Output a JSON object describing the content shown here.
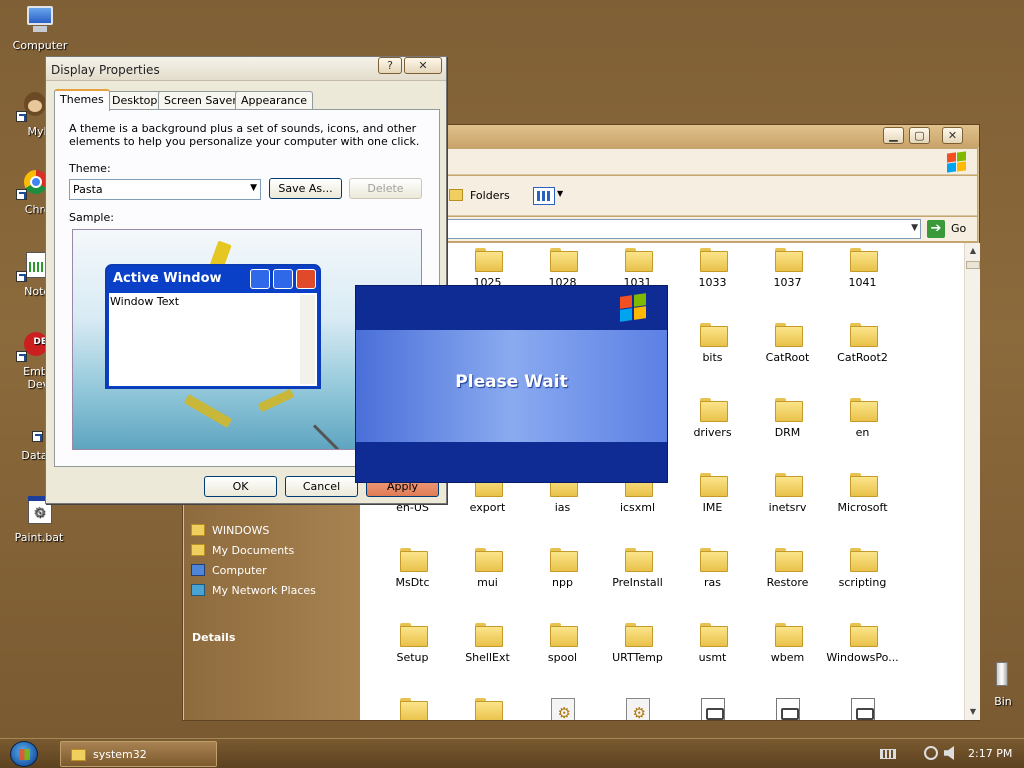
{
  "desktop": {
    "icons": [
      {
        "label": "Computer"
      },
      {
        "label": "MyPa"
      },
      {
        "label": "Chrom"
      },
      {
        "label": "Notepa"
      },
      {
        "label": "Embarc Dev-C"
      },
      {
        "label": "DataWa"
      },
      {
        "label": "Paint.bat"
      },
      {
        "label": "Bin"
      }
    ]
  },
  "explorer": {
    "toolbar": {
      "folders_label": "Folders"
    },
    "address": {
      "value": "",
      "go_label": "Go"
    },
    "tasks": [
      {
        "label": "WINDOWS",
        "icon": "folder-icon"
      },
      {
        "label": "My Documents",
        "icon": "my-documents-icon"
      },
      {
        "label": "Computer",
        "icon": "computer-icon"
      },
      {
        "label": "My Network Places",
        "icon": "network-places-icon"
      }
    ],
    "details_label": "Details",
    "files": [
      {
        "name": "1025",
        "type": "folder"
      },
      {
        "name": "1028",
        "type": "folder"
      },
      {
        "name": "1031",
        "type": "folder"
      },
      {
        "name": "1033",
        "type": "folder"
      },
      {
        "name": "1037",
        "type": "folder"
      },
      {
        "name": "1041",
        "type": "folder"
      },
      {
        "name": "bits",
        "type": "folder"
      },
      {
        "name": "CatRoot",
        "type": "folder"
      },
      {
        "name": "CatRoot2",
        "type": "folder"
      },
      {
        "name": "drivers",
        "type": "folder"
      },
      {
        "name": "DRM",
        "type": "folder"
      },
      {
        "name": "en",
        "type": "folder"
      },
      {
        "name": "en-US",
        "type": "folder"
      },
      {
        "name": "export",
        "type": "folder"
      },
      {
        "name": "ias",
        "type": "folder"
      },
      {
        "name": "icsxml",
        "type": "folder"
      },
      {
        "name": "IME",
        "type": "folder"
      },
      {
        "name": "inetsrv",
        "type": "folder"
      },
      {
        "name": "Microsoft",
        "type": "folder"
      },
      {
        "name": "MsDtc",
        "type": "folder"
      },
      {
        "name": "mui",
        "type": "folder"
      },
      {
        "name": "npp",
        "type": "folder"
      },
      {
        "name": "PreInstall",
        "type": "folder"
      },
      {
        "name": "ras",
        "type": "folder"
      },
      {
        "name": "Restore",
        "type": "folder"
      },
      {
        "name": "scripting",
        "type": "folder"
      },
      {
        "name": "Setup",
        "type": "folder"
      },
      {
        "name": "ShellExt",
        "type": "folder"
      },
      {
        "name": "spool",
        "type": "folder"
      },
      {
        "name": "URTTemp",
        "type": "folder"
      },
      {
        "name": "usmt",
        "type": "folder"
      },
      {
        "name": "wbem",
        "type": "folder"
      },
      {
        "name": "WindowsPo...",
        "type": "folder"
      }
    ]
  },
  "display_properties": {
    "title": "Display Properties",
    "help_button": "?",
    "close_button": "✕",
    "tabs": [
      {
        "label": "Themes"
      },
      {
        "label": "Desktop"
      },
      {
        "label": "Screen Saver"
      },
      {
        "label": "Appearance"
      }
    ],
    "description": "A theme is a background plus a set of sounds, icons, and other elements to help you personalize your computer with one click.",
    "theme_label": "Theme:",
    "theme_value": "Pasta",
    "save_as_label": "Save As...",
    "delete_label": "Delete",
    "sample_label": "Sample:",
    "sample_window": {
      "title": "Active Window",
      "text": "Window Text"
    },
    "ok_label": "OK",
    "cancel_label": "Cancel",
    "apply_label": "Apply"
  },
  "please_wait": {
    "message": "Please Wait"
  },
  "taskbar": {
    "window_button": "system32",
    "clock": "2:17 PM"
  },
  "colors": {
    "desktop": "#7f5f35",
    "xp_blue": "#0f2c95",
    "folder_yellow": "#f3d36b"
  }
}
